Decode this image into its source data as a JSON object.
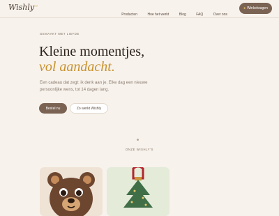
{
  "nav": {
    "logo": "Wishly",
    "logo_mark": "co",
    "links": [
      "Producten",
      "Hoe het werkt",
      "Blog",
      "FAQ",
      "Over ons"
    ],
    "cart_label": "Winkelwagen",
    "cart_icon": "bag-icon"
  },
  "hero": {
    "eyebrow": "GEMAAKT MET LIEFDE",
    "title_line1": "Kleine momentjes,",
    "title_line2": "vol aandacht.",
    "lead": "Een cadeau dat zegt: ik denk aan je. Elke dag een nieuwe persoonlijke wens, tot 14 dagen lang.",
    "primary_cta": "Bestel nu",
    "secondary_cta": "Zo werkt Wishly"
  },
  "products": {
    "section_label": "ONZE WISHLY'S",
    "items": [
      {
        "name": "teddy-bear",
        "icon": "teddy-bear-illustration",
        "bg": "#efe3d6"
      },
      {
        "name": "christmas-tree",
        "icon": "christmas-tree-illustration",
        "bg": "#e4ebd9"
      }
    ]
  },
  "colors": {
    "background": "#f7f2ec",
    "primary": "#7b6354",
    "accent": "#c8922e"
  }
}
